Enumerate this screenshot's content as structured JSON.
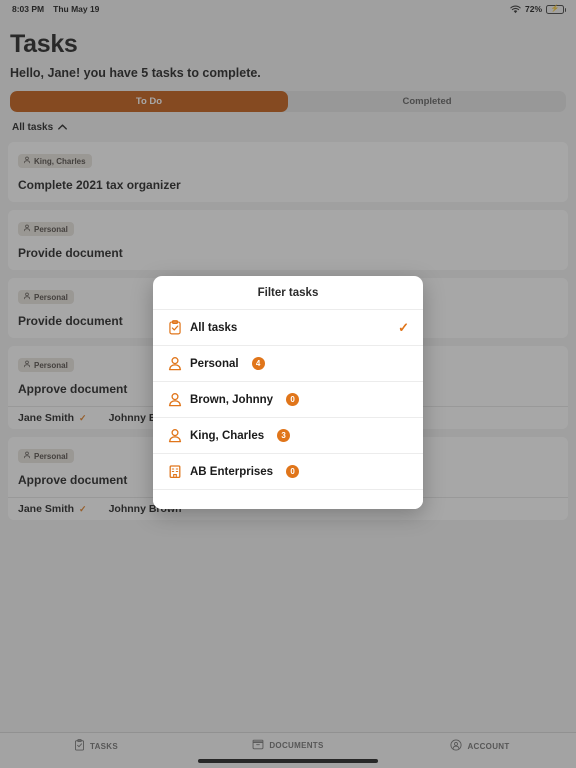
{
  "colors": {
    "accent": "#e0751a",
    "active_segment": "#c2560b",
    "battery_green": "#30d158",
    "card_bg": "#ffffff",
    "app_bg": "#f2f2f2"
  },
  "statusbar": {
    "time": "8:03 PM",
    "date": "Thu May 19",
    "battery_percent": "72%",
    "wifi_icon": "wifi-icon",
    "battery_icon": "battery-charging-icon"
  },
  "header": {
    "title": "Tasks",
    "greeting": "Hello, Jane! you have 5 tasks to complete.",
    "segments": [
      {
        "label": "To Do",
        "active": true
      },
      {
        "label": "Completed",
        "active": false
      }
    ],
    "filter": {
      "label": "All tasks",
      "chevron_icon": "chevron-up-icon"
    }
  },
  "tasks": [
    {
      "badge": "King, Charles",
      "badge_icon": "person-icon",
      "title": "Complete 2021 tax organizer",
      "assignees": []
    },
    {
      "badge": "Personal",
      "badge_icon": "person-icon",
      "title": "Provide document",
      "assignees": []
    },
    {
      "badge": "Personal",
      "badge_icon": "person-icon",
      "title": "Provide document",
      "assignees": []
    },
    {
      "badge": "Personal",
      "badge_icon": "person-icon",
      "title": "Approve document",
      "assignees": [
        {
          "name": "Jane Smith",
          "done": true
        },
        {
          "name": "Johnny Brown",
          "done": false
        }
      ]
    },
    {
      "badge": "Personal",
      "badge_icon": "person-icon",
      "title": "Approve document",
      "assignees": [
        {
          "name": "Jane Smith",
          "done": true
        },
        {
          "name": "Johnny Brown",
          "done": false
        }
      ]
    }
  ],
  "modal": {
    "title": "Filter tasks",
    "items": [
      {
        "label": "All tasks",
        "icon": "clipboard-check-icon",
        "count": null,
        "selected": true
      },
      {
        "label": "Personal",
        "icon": "person-icon",
        "count": "4",
        "selected": false
      },
      {
        "label": "Brown, Johnny",
        "icon": "person-icon",
        "count": "0",
        "selected": false
      },
      {
        "label": "King, Charles",
        "icon": "person-icon",
        "count": "3",
        "selected": false
      },
      {
        "label": "AB Enterprises",
        "icon": "building-icon",
        "count": "0",
        "selected": false
      }
    ],
    "check_glyph": "✓"
  },
  "tabbar": {
    "tabs": [
      {
        "label": "TASKS",
        "icon": "clipboard-check-icon"
      },
      {
        "label": "DOCUMENTS",
        "icon": "archive-box-icon"
      },
      {
        "label": "ACCOUNT",
        "icon": "account-circle-icon"
      }
    ]
  }
}
